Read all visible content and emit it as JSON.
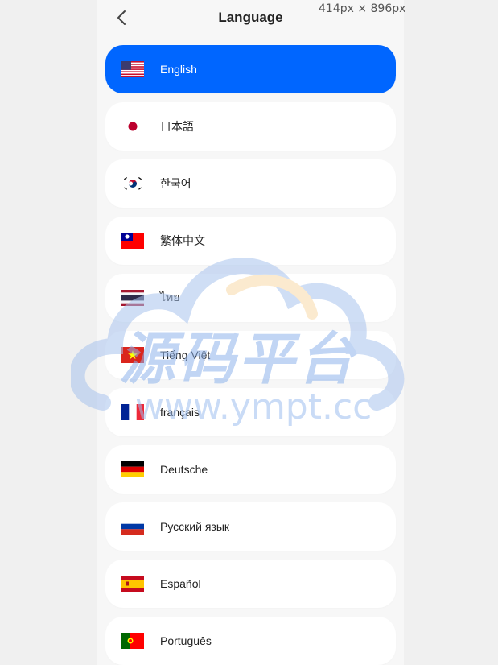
{
  "header": {
    "title": "Language",
    "dimensions_label": "414px × 896px"
  },
  "languages": [
    {
      "label": "English",
      "flag": "us-flag",
      "selected": true
    },
    {
      "label": "日本語",
      "flag": "japan-flag",
      "selected": false
    },
    {
      "label": "한국어",
      "flag": "korea-flag",
      "selected": false
    },
    {
      "label": "繁体中文",
      "flag": "taiwan-flag",
      "selected": false
    },
    {
      "label": "ไทย",
      "flag": "thailand-flag",
      "selected": false
    },
    {
      "label": "Tiếng Việt",
      "flag": "vietnam-flag",
      "selected": false
    },
    {
      "label": "français",
      "flag": "france-flag",
      "selected": false
    },
    {
      "label": "Deutsche",
      "flag": "germany-flag",
      "selected": false
    },
    {
      "label": "Русский язык",
      "flag": "russia-flag",
      "selected": false
    },
    {
      "label": "Español",
      "flag": "spain-flag",
      "selected": false
    },
    {
      "label": "Português",
      "flag": "portugal-flag",
      "selected": false
    }
  ],
  "watermark": {
    "text": "源码平台",
    "url": "www.ympt.cc"
  },
  "colors": {
    "accent": "#0066ff",
    "item_bg": "#ffffff",
    "page_bg": "#f7f7f7"
  }
}
